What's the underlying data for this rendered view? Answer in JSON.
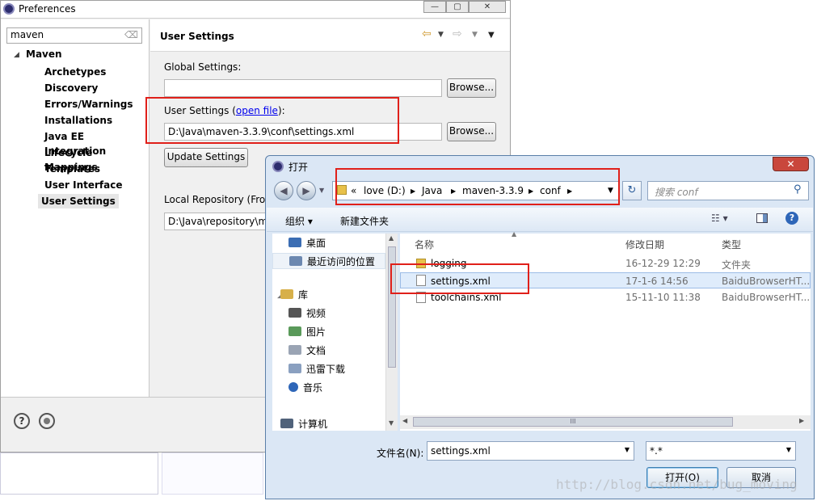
{
  "preferences": {
    "title": "Preferences",
    "filter_value": "maven",
    "tree": {
      "root": "Maven",
      "items": [
        "Archetypes",
        "Discovery",
        "Errors/Warnings",
        "Installations",
        "Java EE Integration",
        "Lifecycle Mappings",
        "Templates",
        "User Interface",
        "User Settings"
      ],
      "selected": "User Settings"
    },
    "page_title": "User Settings",
    "global_label": "Global Settings:",
    "global_value": "",
    "browse_label": "Browse...",
    "user_label": "User Settings (",
    "open_file_link": "open file",
    "user_label_end": "):",
    "user_value": "D:\\Java\\maven-3.3.9\\conf\\settings.xml",
    "update_button": "Update Settings",
    "local_repo_label": "Local Repository (Fro",
    "local_repo_value": "D:\\Java\\repository\\m",
    "help_icon": "?",
    "colors": {
      "highlight": "#e0201a",
      "link": "#0000ee"
    }
  },
  "dialog": {
    "title": "打开",
    "close": "✕",
    "breadcrumbs": [
      "«",
      "love (D:)",
      "Java",
      "maven-3.3.9",
      "conf"
    ],
    "search_placeholder": "搜索 conf",
    "organize": "组织 ▾",
    "new_folder": "新建文件夹",
    "nav": {
      "desktop": "桌面",
      "recent": "最近访问的位置",
      "library": "库",
      "video": "视频",
      "pictures": "图片",
      "documents": "文档",
      "xunlei": "迅雷下载",
      "music": "音乐",
      "computer": "计算机"
    },
    "columns": {
      "name": "名称",
      "date": "修改日期",
      "type": "类型"
    },
    "files": [
      {
        "name": "logging",
        "date": "16-12-29 12:29",
        "type": "文件夹"
      },
      {
        "name": "settings.xml",
        "date": "17-1-6 14:56",
        "type": "BaiduBrowserHT..."
      },
      {
        "name": "toolchains.xml",
        "date": "15-11-10 11:38",
        "type": "BaiduBrowserHT..."
      }
    ],
    "filename_label": "文件名(N):",
    "filename_value": "settings.xml",
    "filter_value": "*.*",
    "open_button": "打开(O)",
    "cancel_button": "取消",
    "scroll_grip": "III"
  },
  "watermark": "http://blog.csdn.net/bug_moving"
}
